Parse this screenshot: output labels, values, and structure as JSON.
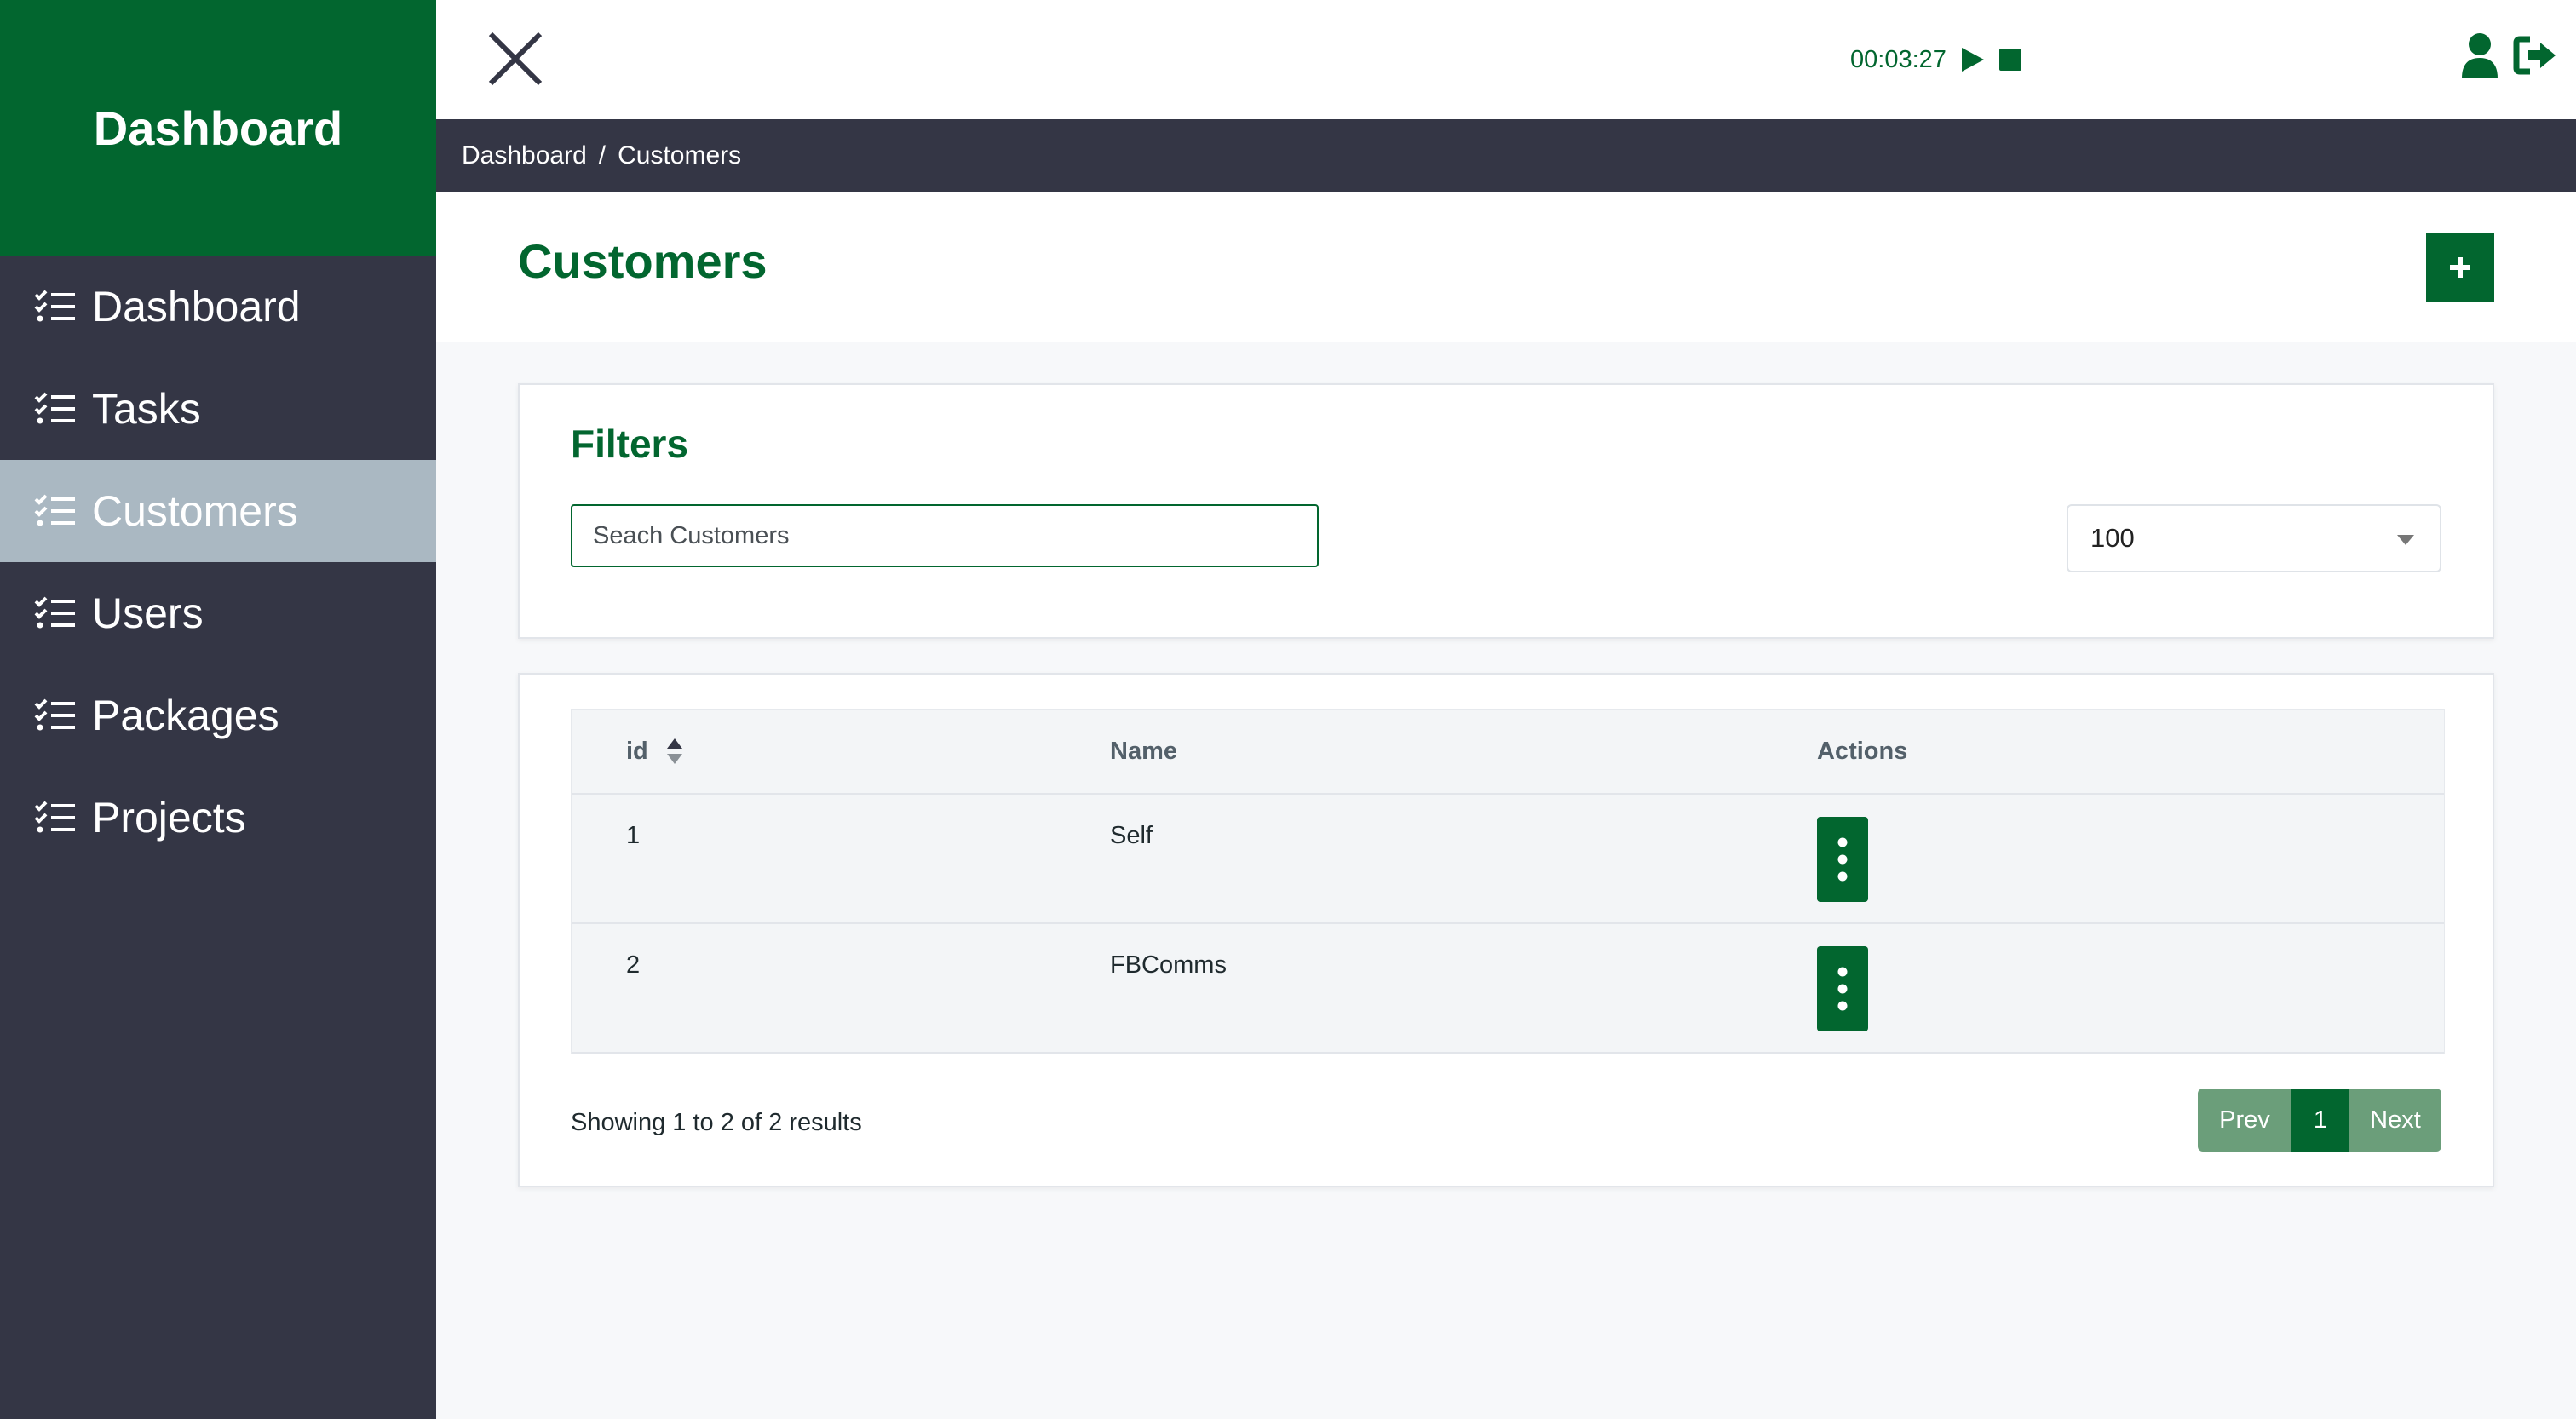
{
  "sidebar": {
    "brand": "Dashboard",
    "items": [
      {
        "label": "Dashboard",
        "icon": "list-check-icon",
        "active": false
      },
      {
        "label": "Tasks",
        "icon": "list-check-icon",
        "active": false
      },
      {
        "label": "Customers",
        "icon": "list-check-icon",
        "active": true
      },
      {
        "label": "Users",
        "icon": "list-check-icon",
        "active": false
      },
      {
        "label": "Packages",
        "icon": "list-check-icon",
        "active": false
      },
      {
        "label": "Projects",
        "icon": "list-check-icon",
        "active": false
      }
    ]
  },
  "topbar": {
    "timer": "00:03:27",
    "icons": [
      "close-icon",
      "play-icon",
      "stop-icon",
      "user-icon",
      "logout-icon"
    ]
  },
  "breadcrumb": {
    "items": [
      "Dashboard",
      "Customers"
    ],
    "separator": "/"
  },
  "page": {
    "title": "Customers",
    "add_button": "+"
  },
  "filters": {
    "title": "Filters",
    "search_placeholder": "Seach Customers",
    "per_page": "100"
  },
  "table": {
    "columns": [
      "id",
      "Name",
      "Actions"
    ],
    "rows": [
      {
        "id": "1",
        "name": "Self"
      },
      {
        "id": "2",
        "name": "FBComms"
      }
    ]
  },
  "pagination": {
    "summary": "Showing 1 to 2 of 2 results",
    "prev": "Prev",
    "current": "1",
    "next": "Next"
  },
  "colors": {
    "brand_green": "#02662f",
    "sidebar_bg": "#343645",
    "active_item_bg": "#aab8c2",
    "pager_inactive": "#6b9e7a"
  }
}
